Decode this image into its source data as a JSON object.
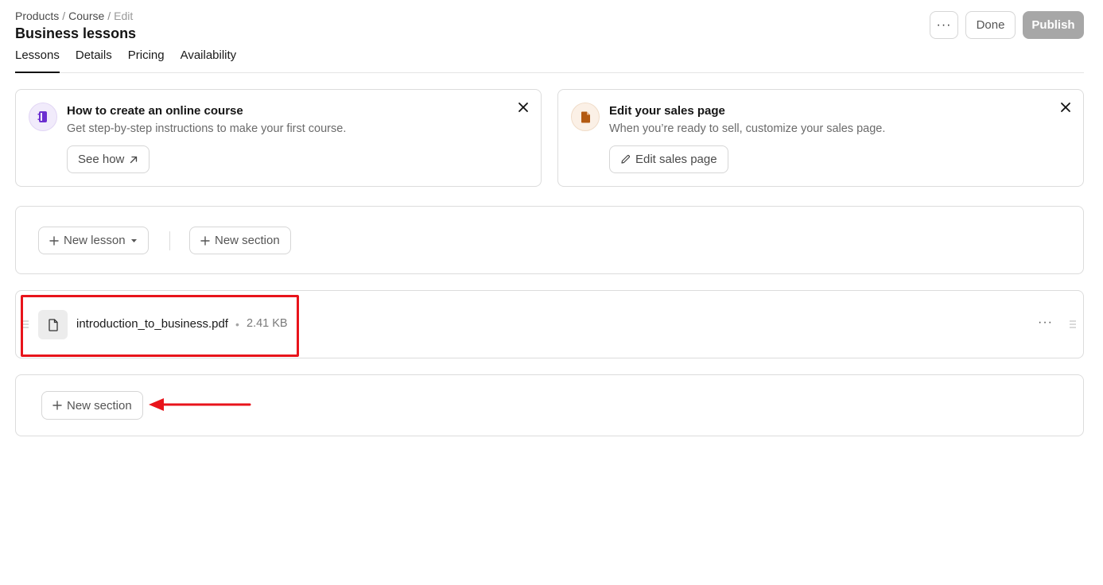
{
  "breadcrumb": {
    "products": "Products",
    "sep1": "/",
    "course": "Course",
    "sep2": "/",
    "edit": "Edit"
  },
  "page_title": "Business lessons",
  "top_actions": {
    "more": "···",
    "done": "Done",
    "publish": "Publish"
  },
  "tabs": [
    {
      "label": "Lessons",
      "active": true
    },
    {
      "label": "Details"
    },
    {
      "label": "Pricing"
    },
    {
      "label": "Availability"
    }
  ],
  "info_cards": [
    {
      "title": "How to create an online course",
      "description": "Get step-by-step instructions to make your first course.",
      "button": "See how",
      "icon": "notebook-icon",
      "accent": "#6b2fd0"
    },
    {
      "title": "Edit your sales page",
      "description": "When you’re ready to sell, customize your sales page.",
      "button": "Edit sales page",
      "icon": "document-icon",
      "accent": "#b35a12"
    }
  ],
  "toolbar": {
    "new_lesson": "New lesson",
    "new_section": "New section"
  },
  "lesson": {
    "file_name": "introduction_to_business.pdf",
    "dot": "•",
    "file_size": "2.41 KB",
    "more": "···"
  },
  "section": {
    "new_section": "New section"
  },
  "colors": {
    "highlight": "#e8141b",
    "publish_bg": "#a7a7a7",
    "border": "#dcdcdc"
  }
}
